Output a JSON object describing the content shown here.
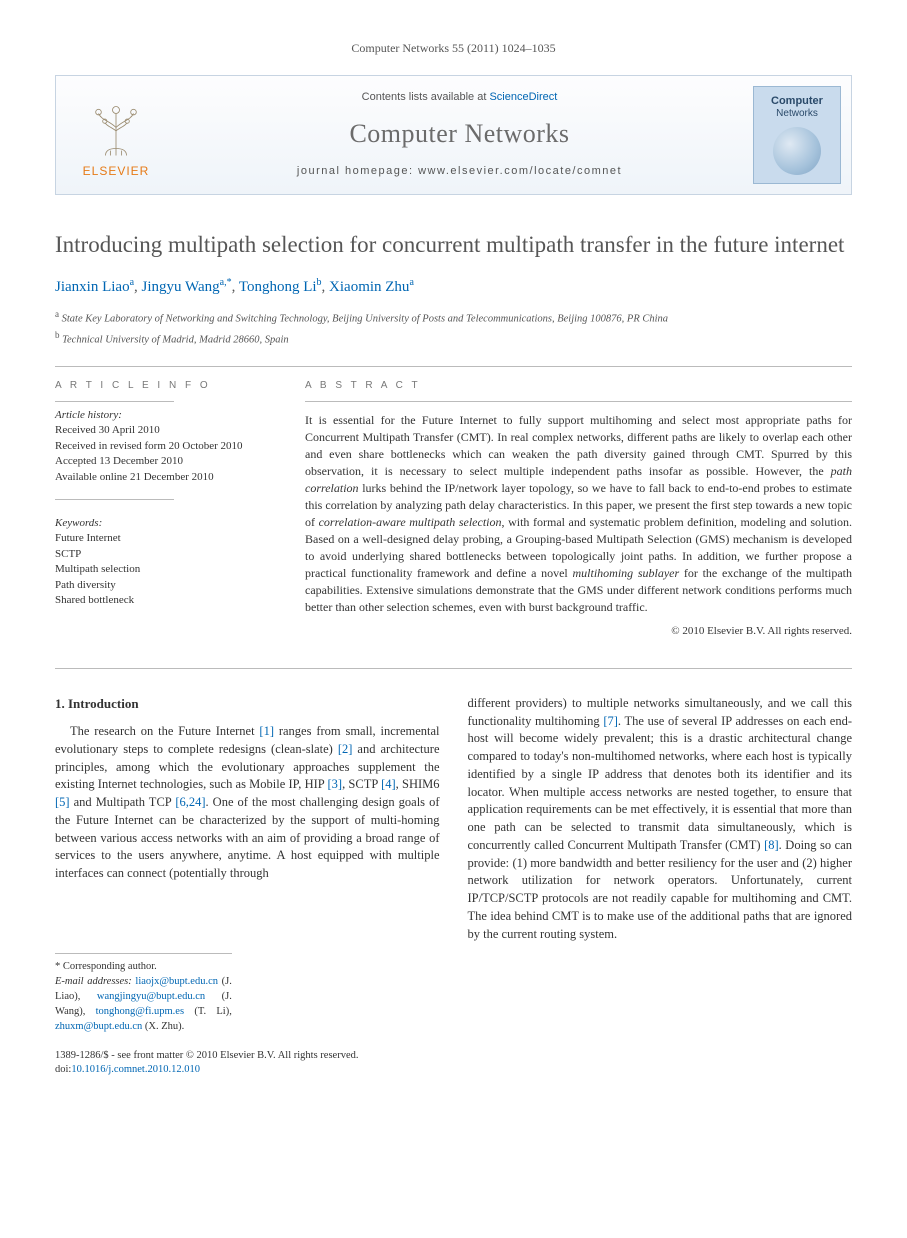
{
  "journal_ref": "Computer Networks 55 (2011) 1024–1035",
  "header": {
    "publisher": "ELSEVIER",
    "contents_prefix": "Contents lists available at ",
    "contents_link": "ScienceDirect",
    "journal_title": "Computer Networks",
    "homepage_prefix": "journal homepage: ",
    "homepage_url": "www.elsevier.com/locate/comnet",
    "cover_label1": "Computer",
    "cover_label2": "Networks"
  },
  "paper": {
    "title": "Introducing multipath selection for concurrent multipath transfer in the future internet",
    "authors": [
      {
        "name": "Jianxin Liao",
        "aff": "a"
      },
      {
        "name": "Jingyu Wang",
        "aff": "a,*"
      },
      {
        "name": "Tonghong Li",
        "aff": "b"
      },
      {
        "name": "Xiaomin Zhu",
        "aff": "a"
      }
    ],
    "affiliations": {
      "a": "State Key Laboratory of Networking and Switching Technology, Beijing University of Posts and Telecommunications, Beijing 100876, PR China",
      "b": "Technical University of Madrid, Madrid 28660, Spain"
    }
  },
  "article_info": {
    "head": "A R T I C L E   I N F O",
    "history_head": "Article history:",
    "received": "Received 30 April 2010",
    "revised": "Received in revised form 20 October 2010",
    "accepted": "Accepted 13 December 2010",
    "online": "Available online 21 December 2010",
    "keywords_head": "Keywords:",
    "keywords": [
      "Future Internet",
      "SCTP",
      "Multipath selection",
      "Path diversity",
      "Shared bottleneck"
    ]
  },
  "abstract": {
    "head": "A B S T R A C T",
    "text_html": "It is essential for the Future Internet to fully support multihoming and select most appropriate paths for Concurrent Multipath Transfer (CMT). In real complex networks, different paths are likely to overlap each other and even share bottlenecks which can weaken the path diversity gained through CMT. Spurred by this observation, it is necessary to select multiple independent paths insofar as possible. However, the <em>path correlation</em> lurks behind the IP/network layer topology, so we have to fall back to end-to-end probes to estimate this correlation by analyzing path delay characteristics. In this paper, we present the first step towards a new topic of <em>correlation-aware multipath selection</em>, with formal and systematic problem definition, modeling and solution. Based on a well-designed delay probing, a Grouping-based Multipath Selection (GMS) mechanism is developed to avoid underlying shared bottlenecks between topologically joint paths. In addition, we further propose a practical functionality framework and define a novel <em>multihoming sublayer</em> for the exchange of the multipath capabilities. Extensive simulations demonstrate that the GMS under different network conditions performs much better than other selection schemes, even with burst background traffic.",
    "copyright": "© 2010 Elsevier B.V. All rights reserved."
  },
  "body": {
    "sec1_title": "1. Introduction",
    "para1_html": "The research on the Future Internet <a href='#'>[1]</a> ranges from small, incremental evolutionary steps to complete redesigns (clean-slate) <a href='#'>[2]</a> and architecture principles, among which the evolutionary approaches supplement the existing Internet technologies, such as Mobile IP, HIP <a href='#'>[3]</a>, SCTP <a href='#'>[4]</a>, SHIM6 <a href='#'>[5]</a> and Multipath TCP <a href='#'>[6,24]</a>. One of the most challenging design goals of the Future Internet can be characterized by the support of multi-homing between various access networks with an aim of providing a broad range of services to the users anywhere, anytime. A host equipped with multiple interfaces can connect (potentially through",
    "para2_html": "different providers) to multiple networks simultaneously, and we call this functionality multihoming <a href='#'>[7]</a>. The use of several IP addresses on each end-host will become widely prevalent; this is a drastic architectural change compared to today's non-multihomed networks, where each host is typically identified by a single IP address that denotes both its identifier and its locator. When multiple access networks are nested together, to ensure that application requirements can be met effectively, it is essential that more than one path can be selected to transmit data simultaneously, which is concurrently called Concurrent Multipath Transfer (CMT) <a href='#'>[8]</a>. Doing so can provide: (1) more bandwidth and better resiliency for the user and (2) higher network utilization for network operators. Unfortunately, current IP/TCP/SCTP protocols are not readily capable for multihoming and CMT. The idea behind CMT is to make use of the additional paths that are ignored by the current routing system."
  },
  "footnotes": {
    "corr": "* Corresponding author.",
    "emails_label": "E-mail addresses:",
    "emails_html": "<a href='#'>liaojx@bupt.edu.cn</a> (J. Liao), <a href='#'>wangjingyu@bupt.edu.cn</a> (J. Wang), <a href='#'>tonghong@fi.upm.es</a> (T. Li), <a href='#'>zhuxm@bupt.edu.cn</a> (X. Zhu)."
  },
  "doi": {
    "front_matter": "1389-1286/$ - see front matter © 2010 Elsevier B.V. All rights reserved.",
    "doi_label": "doi:",
    "doi_link": "10.1016/j.comnet.2010.12.010"
  }
}
